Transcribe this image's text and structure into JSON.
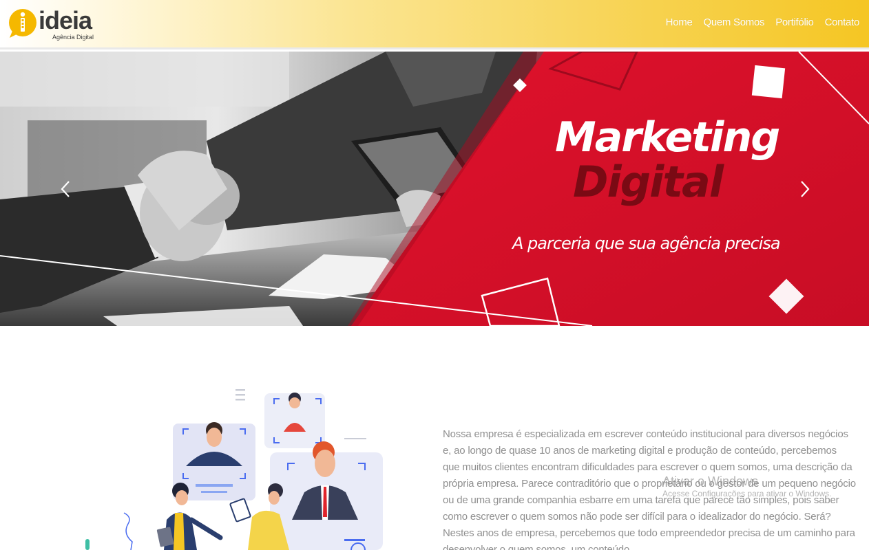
{
  "brand": {
    "name": "ideia",
    "tagline": "Agência Digital",
    "accent": "#f5c623"
  },
  "nav": {
    "items": [
      {
        "label": "Home"
      },
      {
        "label": "Quem Somos"
      },
      {
        "label": "Portifólio"
      },
      {
        "label": "Contato"
      }
    ]
  },
  "hero": {
    "title_line1": "Marketing",
    "title_line2": "Digital",
    "subtitle": "A parceria que sua agência precisa",
    "prev_icon": "chevron-left-icon",
    "next_icon": "chevron-right-icon",
    "red": "#d8102a",
    "dark_red": "#7a0a14"
  },
  "about": {
    "paragraph": "Nossa empresa é especializada em escrever conteúdo institucional para diversos negócios e, ao longo de quase 10 anos de marketing digital e produção de conteúdo, percebemos que muitos clientes encontram dificuldades para escrever o quem somos, uma descrição da própria empresa. Parece contraditório que o proprietário ou o gestor de um pequeno negócio ou de uma grande companhia esbarre em uma tarefa que parece tão simples, pois saber como escrever o quem somos não pode ser difícil para o idealizador do negócio. Será? Nestes anos de empresa, percebemos que todo empreendedor precisa de um caminho para desenvolver o quem somos, um conteúdo"
  },
  "watermark": {
    "line1": "Ativar o Windows",
    "line2": "Acesse Configurações para ativar o Windows."
  }
}
